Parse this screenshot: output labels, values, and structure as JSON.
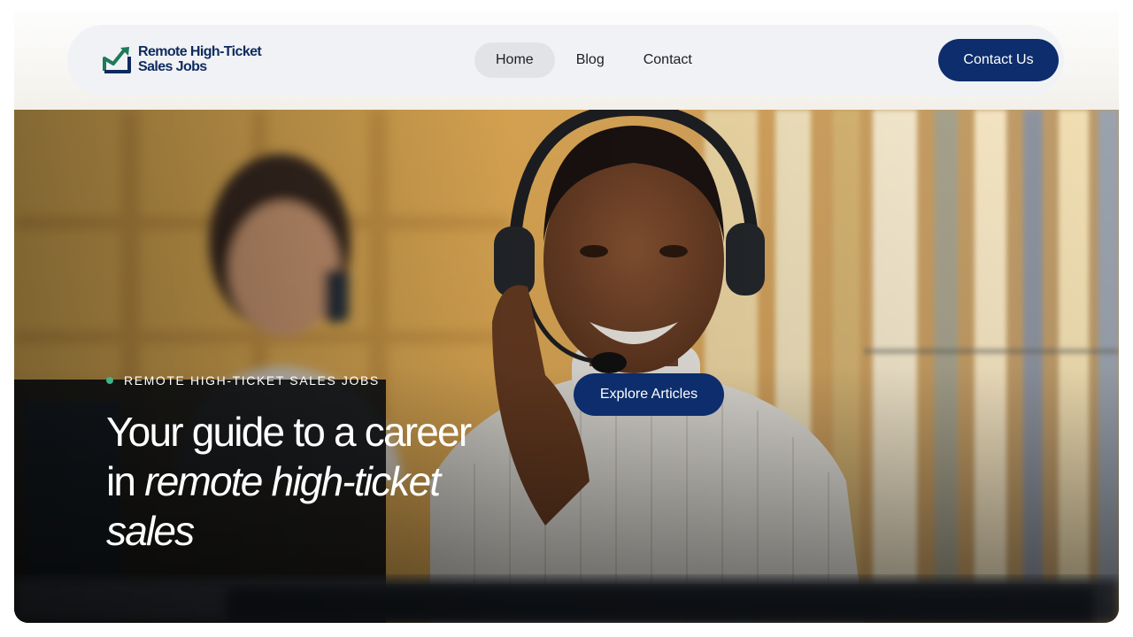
{
  "brand": {
    "name_line1": "Remote High-Ticket",
    "name_line2": "Sales Jobs",
    "logo_icon": "trend-chart-icon",
    "color_primary": "#0d2d6c",
    "color_accent": "#1e7a5a"
  },
  "nav": {
    "items": [
      {
        "label": "Home",
        "active": true
      },
      {
        "label": "Blog",
        "active": false
      },
      {
        "label": "Contact",
        "active": false
      }
    ],
    "cta_label": "Contact Us"
  },
  "hero": {
    "kicker": "REMOTE HIGH-TICKET SALES JOBS",
    "headline_line1": "Your guide to a career",
    "headline_in": "in ",
    "headline_em1": "remote high-ticket",
    "headline_em2": "sales",
    "button_label": "Explore Articles",
    "image_description_icon": "photo-call-center-icon"
  }
}
